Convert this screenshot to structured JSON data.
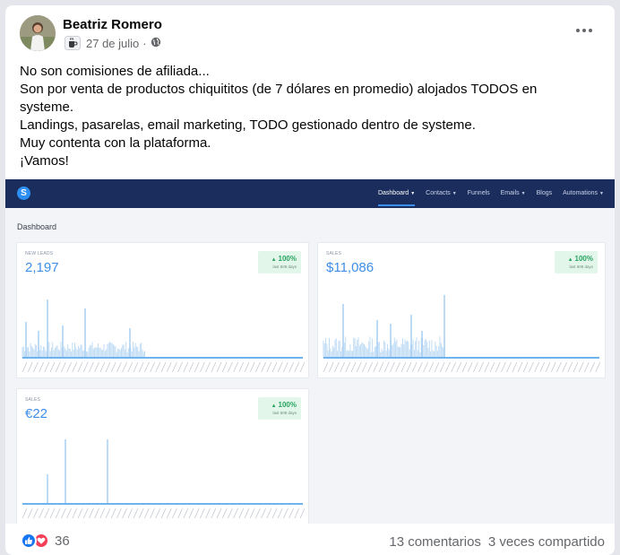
{
  "post": {
    "author": "Beatriz Romero",
    "date": "27 de julio",
    "separator": "·",
    "text_lines": [
      "No son comisiones de afiliada...",
      "Son por venta de productos chiquititos (de 7 dólares en promedio) alojados TODOS en systeme.",
      "Landings, pasarelas, email marketing, TODO gestionado dentro de systeme.",
      "Muy contenta con la plataforma.",
      "¡Vamos!"
    ]
  },
  "screenshot": {
    "logo_letter": "S",
    "nav": [
      {
        "label": "Dashboard",
        "caret": true,
        "active": true
      },
      {
        "label": "Contacts",
        "caret": true,
        "active": false
      },
      {
        "label": "Funnels",
        "caret": false,
        "active": false
      },
      {
        "label": "Emails",
        "caret": true,
        "active": false
      },
      {
        "label": "Blogs",
        "caret": false,
        "active": false
      },
      {
        "label": "Automations",
        "caret": true,
        "active": false
      }
    ],
    "page_label": "Dashboard",
    "panels": [
      {
        "title": "NEW LEADS",
        "value": "2,197",
        "badge_pct": "100%",
        "badge_sub": "last 609 days"
      },
      {
        "title": "SALES",
        "value": "$11,086",
        "badge_pct": "100%",
        "badge_sub": "last 609 days"
      },
      {
        "title": "SALES",
        "value": "€22",
        "badge_pct": "100%",
        "badge_sub": "last 609 days"
      }
    ],
    "accent_color": "#3f8ee8",
    "badge_color": "#27a461"
  },
  "footer": {
    "reaction_count": "36",
    "comments": "13 comentarios",
    "shares": "3 veces compartido"
  }
}
